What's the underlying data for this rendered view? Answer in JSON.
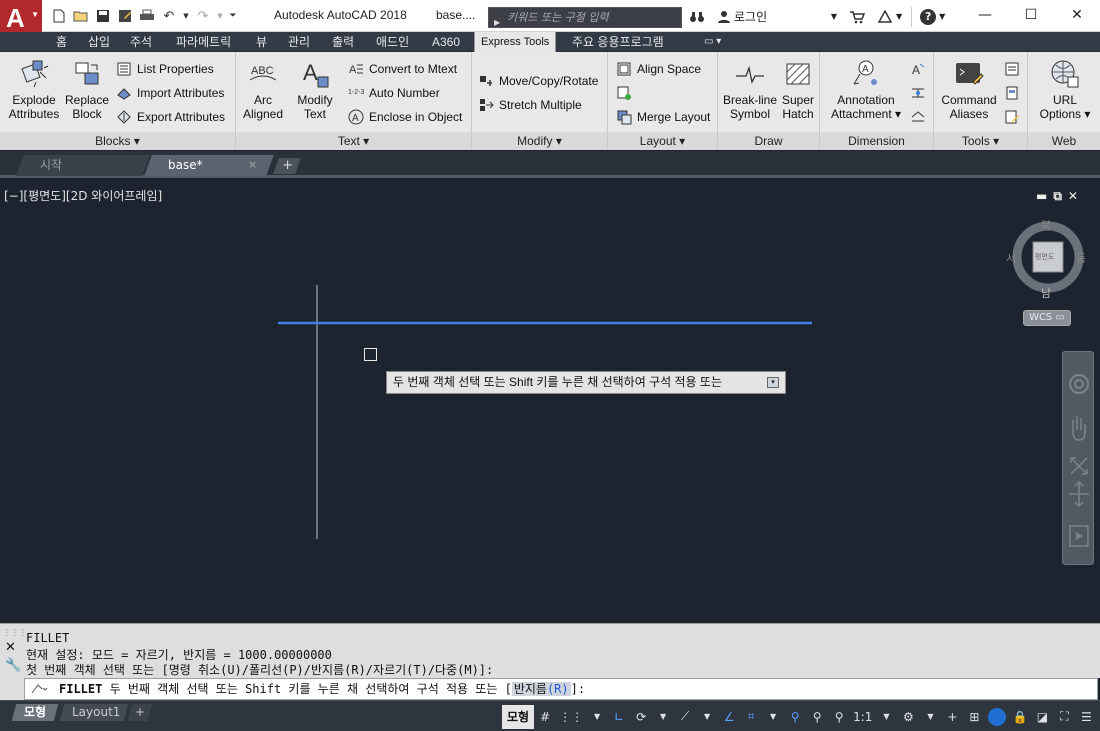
{
  "title_bar": {
    "logo_text": "A",
    "app_title": "Autodesk AutoCAD 2018",
    "doc_title": "base....",
    "search_placeholder": "키워드 또는 구절 입력",
    "login_label": "로그인",
    "help_label": "?"
  },
  "ribbon_tabs": [
    {
      "label": "홈"
    },
    {
      "label": "삽입"
    },
    {
      "label": "주석"
    },
    {
      "label": "파라메트릭"
    },
    {
      "label": "뷰"
    },
    {
      "label": "관리"
    },
    {
      "label": "출력"
    },
    {
      "label": "애드인"
    },
    {
      "label": "A360"
    },
    {
      "label": "Express Tools"
    },
    {
      "label": "주요 응용프로그램"
    }
  ],
  "active_tab": "Express Tools",
  "ribbon": {
    "blocks": {
      "title": "Blocks",
      "explode_line1": "Explode",
      "explode_line2": "Attributes",
      "replace_line1": "Replace",
      "replace_line2": "Block",
      "list_properties": "List Properties",
      "import_attributes": "Import Attributes",
      "export_attributes": "Export Attributes"
    },
    "text": {
      "title": "Text",
      "arc_line1": "Arc",
      "arc_line2": "Aligned",
      "modify_line1": "Modify",
      "modify_line2": "Text",
      "convert_to_mtext": "Convert to Mtext",
      "auto_number": "Auto Number",
      "enclose_in_object": "Enclose in Object"
    },
    "modify": {
      "title": "Modify",
      "move_copy_rotate": "Move/Copy/Rotate",
      "stretch_multiple": "Stretch Multiple"
    },
    "layout": {
      "title": "Layout",
      "align_space": "Align Space",
      "merge_layout": "Merge Layout"
    },
    "draw": {
      "title": "Draw",
      "breakline_line1": "Break-line",
      "breakline_line2": "Symbol",
      "superhatch_line1": "Super",
      "superhatch_line2": "Hatch"
    },
    "dimension": {
      "title": "Dimension",
      "annotation_line1": "Annotation",
      "annotation_line2": "Attachment"
    },
    "tools": {
      "title": "Tools",
      "command_line1": "Command",
      "command_line2": "Aliases"
    },
    "web": {
      "title": "Web",
      "url_line1": "URL",
      "url_line2": "Options"
    }
  },
  "doc_tabs": {
    "start": "시작",
    "base": "base*",
    "close_glyph": "×",
    "new_glyph": "+"
  },
  "viewport": {
    "label": "[−][평면도][2D 와이어프레임]",
    "tooltip": "두 번째 객체 선택 또는 Shift 키를 누른 채 선택하여 구석 적용 또는"
  },
  "viewcube": {
    "north": "북",
    "south": "남",
    "east": "동",
    "west": "서",
    "face": "평면도",
    "wcs": "WCS"
  },
  "command": {
    "history": [
      "FILLET",
      "현재 설정: 모드 = 자르기, 반지름 = 1000.00000000",
      "첫 번째 객체 선택 또는 [명령 취소(U)/폴리선(P)/반지름(R)/자르기(T)/다중(M)]:"
    ],
    "prompt_cmd": "FILLET",
    "prompt_text": "두 번째 객체 선택 또는 Shift 키를 누른 채 선택하여 구석 적용 또는 [",
    "prompt_keyword": "반지름",
    "prompt_hotkey": "(R)",
    "prompt_end": "]:"
  },
  "layout_tabs": {
    "model": "모형",
    "layout1": "Layout1",
    "new": "+"
  },
  "status_bar": {
    "model_button": "모형",
    "scale": "1:1"
  },
  "colors": {
    "canvas_bg": "#1d232f",
    "selected_line": "#3f7fe8",
    "logo_red": "#b3282d"
  }
}
